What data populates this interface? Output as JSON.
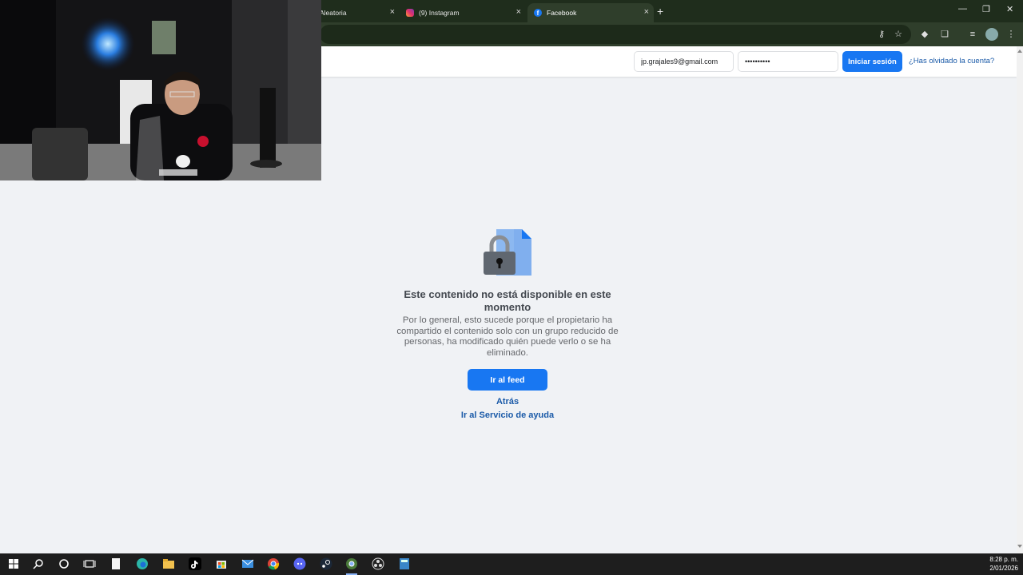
{
  "browser": {
    "tabs": [
      {
        "title": "Aleatoria",
        "active": false
      },
      {
        "title": "(9) Instagram",
        "active": false
      },
      {
        "title": "Facebook",
        "active": true
      }
    ],
    "close_glyph": "×",
    "new_tab_glyph": "+"
  },
  "header": {
    "email_value": "jp.grajales9@gmail.com",
    "password_value": "••••••••••",
    "login_label": "Iniciar sesión",
    "forgot_label": "¿Has olvidado la cuenta?"
  },
  "main": {
    "title": "Este contenido no está disponible en este momento",
    "description": "Por lo general, esto sucede porque el propietario ha compartido el contenido solo con un grupo reducido de personas, ha modificado quién puede verlo o se ha eliminado.",
    "feed_button": "Ir al feed",
    "back_link": "Atrás",
    "help_link": "Ir al Servicio de ayuda"
  },
  "taskbar": {
    "time": "8:28 p. m.",
    "date": "2/01/2026"
  },
  "colors": {
    "brand": "#1877f2",
    "link": "#1a5aa8",
    "page_bg": "#f0f2f5"
  }
}
